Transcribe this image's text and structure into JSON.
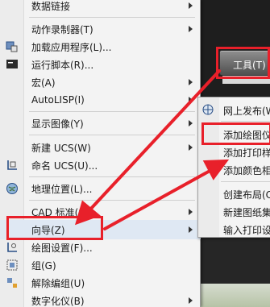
{
  "tools_button": {
    "label": "工具(T)"
  },
  "tools_menu": {
    "items": [
      {
        "label": "数据链接",
        "icon": "none",
        "has_submenu": true
      },
      {
        "label": "动作录制器(T)",
        "icon": "none",
        "has_submenu": true
      },
      {
        "label": "加载应用程序(L)...",
        "icon": "app-load-icon",
        "has_submenu": false
      },
      {
        "label": "运行脚本(R)...",
        "icon": "script-icon",
        "has_submenu": false
      },
      {
        "label": "宏(A)",
        "icon": "none",
        "has_submenu": true
      },
      {
        "label": "AutoLISP(I)",
        "icon": "none",
        "has_submenu": true
      },
      {
        "label": "显示图像(Y)",
        "icon": "none",
        "has_submenu": true
      },
      {
        "label": "新建 UCS(W)",
        "icon": "new-ucs-icon",
        "has_submenu": true
      },
      {
        "label": "命名 UCS(U)...",
        "icon": "named-ucs-icon",
        "has_submenu": false
      },
      {
        "label": "地理位置(L)...",
        "icon": "globe-icon",
        "has_submenu": false
      },
      {
        "label": "CAD 标准(S)",
        "icon": "none",
        "has_submenu": true
      },
      {
        "label": "向导(Z)",
        "icon": "none",
        "has_submenu": true
      },
      {
        "label": "绘图设置(F)...",
        "icon": "drafting-settings-icon",
        "has_submenu": false
      },
      {
        "label": "组(G)",
        "icon": "group-icon",
        "has_submenu": false
      },
      {
        "label": "解除编组(U)",
        "icon": "ungroup-icon",
        "has_submenu": false
      },
      {
        "label": "数字化仪(B)",
        "icon": "none",
        "has_submenu": true
      }
    ]
  },
  "wizard_submenu": {
    "items": [
      {
        "label": "网上发布(W",
        "icon": "publish-web-icon"
      },
      {
        "label": "添加绘图仪",
        "icon": "none"
      },
      {
        "label": "添加打印样",
        "icon": "none"
      },
      {
        "label": "添加颜色相",
        "icon": "none"
      },
      {
        "label": "创建布局(C",
        "icon": "none"
      },
      {
        "label": "新建图纸集",
        "icon": "none"
      },
      {
        "label": "输入打印设",
        "icon": "none"
      }
    ]
  },
  "colors": {
    "highlight_red": "#e8202a",
    "accent_blue": "#2a4f86"
  }
}
